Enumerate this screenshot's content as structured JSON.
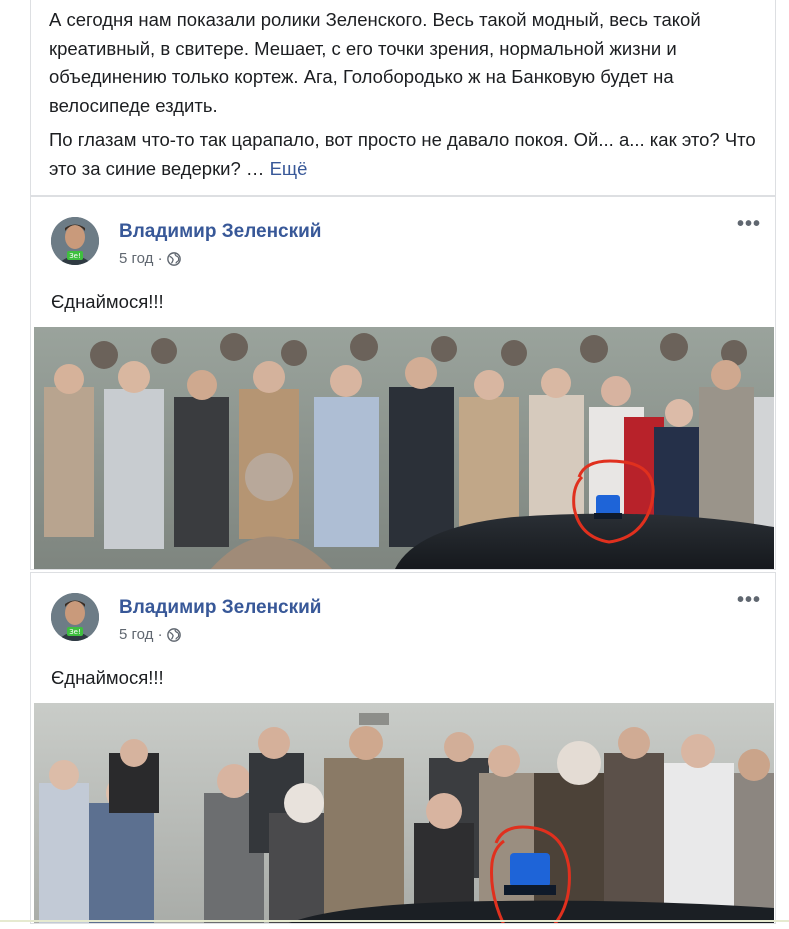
{
  "post": {
    "paragraph1": "А сегодня нам показали ролики Зеленского. Весь такой модный, весь такой креативный, в свитере. Мешает, с его точки зрения, нормальной жизни и объединению только кортеж. Ага, Голобородько ж на Банковую будет на велосипеде ездить.",
    "paragraph2": "По глазам что-то так царапало, вот просто не давало покоя. Ой... а... как это? Что это за синие ведерки? …",
    "see_more": "Ещё"
  },
  "shared_posts": [
    {
      "author": "Владимир Зеленский",
      "time": "5 год ·",
      "caption": "Єднаймося!!!",
      "more": "•••",
      "avatar_badge": "Зе!"
    },
    {
      "author": "Владимир Зеленский",
      "time": "5 год ·",
      "caption": "Єднаймося!!!",
      "more": "•••",
      "avatar_badge": "Зе!"
    }
  ],
  "colors": {
    "link": "#385898",
    "text": "#1c1e21",
    "meta": "#606770",
    "circle_annotation": "#e0301e",
    "siren": "#1e64d8"
  },
  "icons": {
    "privacy": "globe-icon",
    "options": "more-options-icon"
  }
}
